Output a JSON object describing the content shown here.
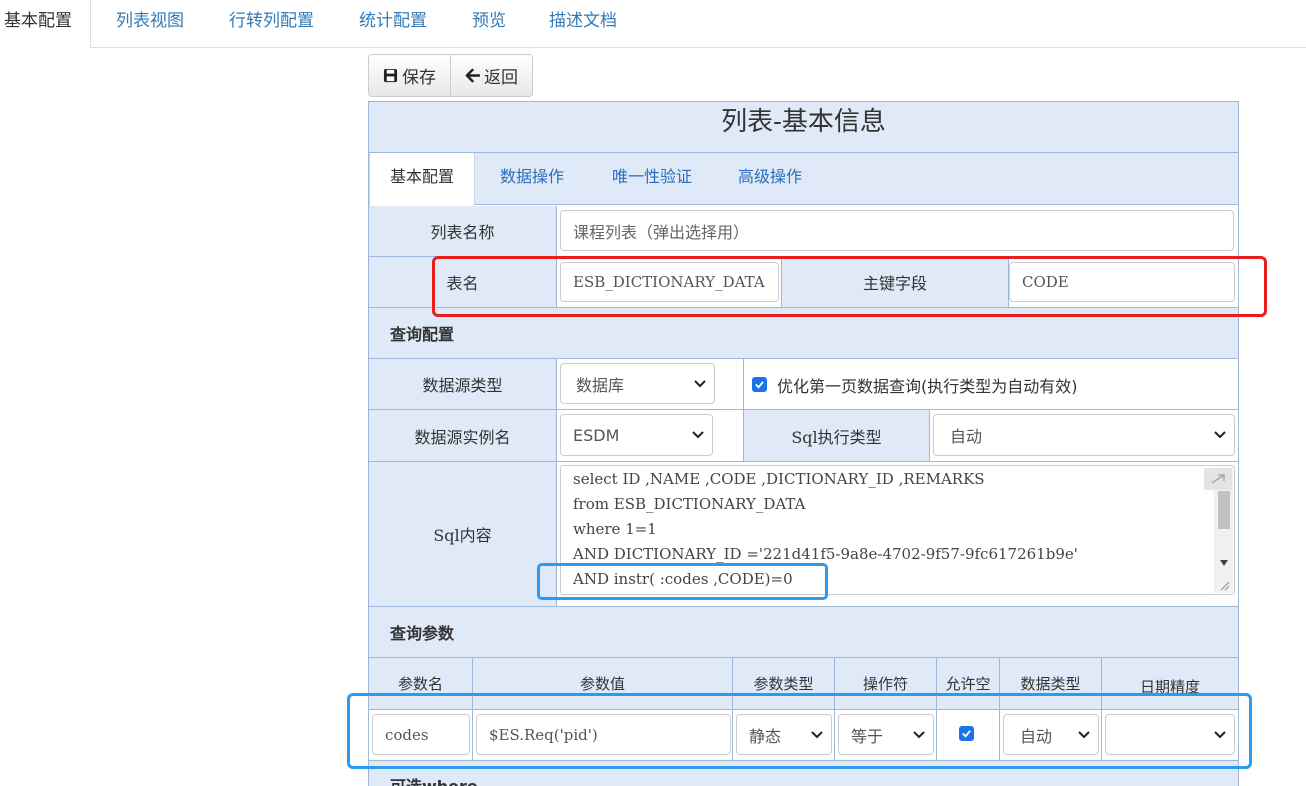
{
  "top_tabs": [
    {
      "label": "基本配置",
      "active": true
    },
    {
      "label": "列表视图"
    },
    {
      "label": "行转列配置"
    },
    {
      "label": "统计配置"
    },
    {
      "label": "预览"
    },
    {
      "label": "描述文档"
    }
  ],
  "toolbar": {
    "save_label": "保存",
    "back_label": "返回"
  },
  "panel": {
    "title": "列表-基本信息",
    "tabs": [
      {
        "label": "基本配置",
        "active": true
      },
      {
        "label": "数据操作"
      },
      {
        "label": "唯一性验证"
      },
      {
        "label": "高级操作"
      }
    ]
  },
  "form": {
    "list_name_label": "列表名称",
    "list_name_value": "课程列表（弹出选择用）",
    "table_name_label": "表名",
    "table_name_value": "ESB_DICTIONARY_DATA",
    "pk_label": "主键字段",
    "pk_value": "CODE",
    "query_section": "查询配置",
    "ds_type_label": "数据源类型",
    "ds_type_value": "数据库",
    "optimize_label": "优化第一页数据查询(执行类型为自动有效)",
    "optimize_checked": true,
    "ds_instance_label": "数据源实例名",
    "ds_instance_value": "ESDM",
    "sql_exec_label": "Sql执行类型",
    "sql_exec_value": "自动",
    "sql_label": "Sql内容",
    "sql_lines": [
      "select ID ,NAME ,CODE ,DICTIONARY_ID ,REMARKS",
      "from ESB_DICTIONARY_DATA",
      "where 1=1",
      "AND DICTIONARY_ID ='221d41f5-9a8e-4702-9f57-9fc617261b9e'",
      "AND instr( :codes ,CODE)=0"
    ],
    "params_section": "查询参数",
    "params_headers": [
      "参数名",
      "参数值",
      "参数类型",
      "操作符",
      "允许空",
      "数据类型",
      "日期精度"
    ],
    "params_row": {
      "name": "codes",
      "value": "$ES.Req('pid')",
      "type": "静态",
      "operator": "等于",
      "nullable": true,
      "data_type": "自动",
      "date_precision": ""
    },
    "optional_where_section": "可选where"
  },
  "colors": {
    "accent": "#337ab7",
    "label_bg": "#dfe9f7",
    "border": "#9fb8d9",
    "highlight_red": "#e81d1d",
    "highlight_blue": "#2b9bf2"
  }
}
